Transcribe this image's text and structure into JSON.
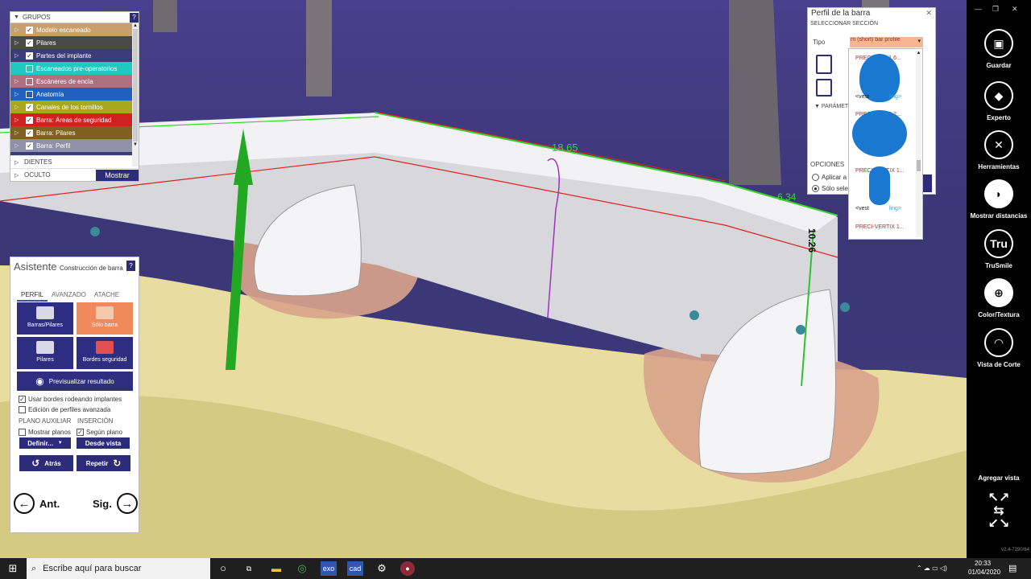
{
  "viewport": {
    "measure_top": "18.65",
    "measure_right": "6.34",
    "measure_vertical": "10.26"
  },
  "groups": {
    "header": "GRUPOS",
    "help": "?",
    "items": [
      {
        "label": "Modelo escaneado",
        "checked": true,
        "color": "#c8a070"
      },
      {
        "label": "Pilares",
        "checked": true,
        "color": "#4a4a4a"
      },
      {
        "label": "Partes del implante",
        "checked": true,
        "color": "#3b3b7a"
      },
      {
        "label": "Escaneados pre-operatorios",
        "checked": false,
        "color": "#20c8c0"
      },
      {
        "label": "Escáneres de encía",
        "checked": false,
        "color": "#b07080"
      },
      {
        "label": "Anatomía",
        "checked": false,
        "color": "#2060c0"
      },
      {
        "label": "Canales de los tornillos",
        "checked": true,
        "color": "#a8a820"
      },
      {
        "label": "Barra: Áreas de seguridad",
        "checked": true,
        "color": "#d02020"
      },
      {
        "label": "Barra: Pilares",
        "checked": true,
        "color": "#806020"
      },
      {
        "label": "Barra: Perfil",
        "checked": true,
        "color": "#9090a8"
      }
    ],
    "teeth": "DIENTES",
    "hidden": "OCULTO",
    "show": "Mostrar"
  },
  "assistant": {
    "title": "Asistente",
    "subtitle": "Construcción de barra",
    "help": "?",
    "tabs": [
      "PERFIL",
      "AVANZADO",
      "ATACHE"
    ],
    "tiles": [
      "Barras/Pilares",
      "Sólo barra",
      "Pilares",
      "Bordes seguridad"
    ],
    "preview": "Previsualizar resultado",
    "check1": "Usar bordes rodeando implantes",
    "check2": "Edición de perfiles avanzada",
    "plane_label": "PLANO AUXILIAR",
    "insertion_label": "INSERCIÓN",
    "show_planes": "Mostrar planos",
    "according_plane": "Según plano",
    "define": "Definir...",
    "from_view": "Desde vista",
    "back": "Atrás",
    "redo": "Repetir",
    "prev": "Ant.",
    "next": "Sig."
  },
  "profile": {
    "title": "Perfil de la barra",
    "section": "SELECCIONAR SECCIÓN",
    "type_label": "Tipo",
    "type_value": "rn (short) bar profile",
    "params": "PARÁMET",
    "options": "OPCIONES",
    "apply": "Aplicar a t",
    "only": "Sólo selec",
    "items": [
      "PRECI-LINE 1.6...",
      "PRECI-LINE 2.2...",
      "PRECI-VERTIX 1...",
      "PRECI-VERTIX 1..."
    ],
    "vest": "<vest",
    "ling": "ling>"
  },
  "toolbar": {
    "items": [
      "Guardar",
      "Experto",
      "Herramientas",
      "Mostrar distancias",
      "TruSmile",
      "Color/Textura",
      "Vista de Corte"
    ],
    "add_view": "Agregar vista",
    "version": "v2.4-7290/64"
  },
  "taskbar": {
    "search": "Escribe aquí para buscar",
    "time": "20:33",
    "date": "01/04/2020",
    "exo": "exo",
    "cad": "cad"
  }
}
